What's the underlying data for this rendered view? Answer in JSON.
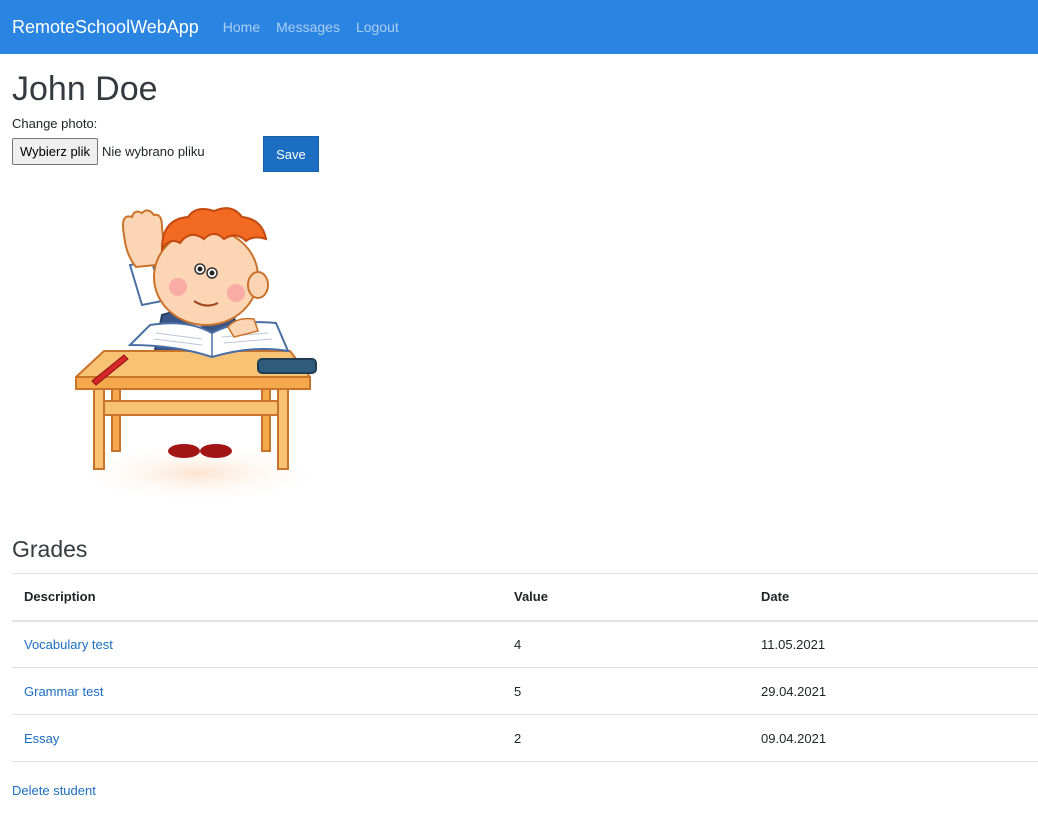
{
  "navbar": {
    "brand": "RemoteSchoolWebApp",
    "links": [
      "Home",
      "Messages",
      "Logout"
    ]
  },
  "student": {
    "name": "John Doe"
  },
  "upload": {
    "label": "Change photo:",
    "choose_button": "Wybierz plik",
    "status": "Nie wybrano pliku",
    "save_button": "Save"
  },
  "grades": {
    "title": "Grades",
    "headers": [
      "Description",
      "Value",
      "Date"
    ],
    "rows": [
      {
        "description": "Vocabulary test",
        "value": "4",
        "date": "11.05.2021"
      },
      {
        "description": "Grammar test",
        "value": "5",
        "date": "29.04.2021"
      },
      {
        "description": "Essay",
        "value": "2",
        "date": "09.04.2021"
      }
    ]
  },
  "actions": {
    "delete": "Delete student"
  },
  "colors": {
    "navbar": "#2a84e1",
    "primary": "#1b6ec2",
    "link": "#1b6ec2"
  },
  "images": {
    "photo": "cartoon boy sitting at school desk raising hand"
  }
}
